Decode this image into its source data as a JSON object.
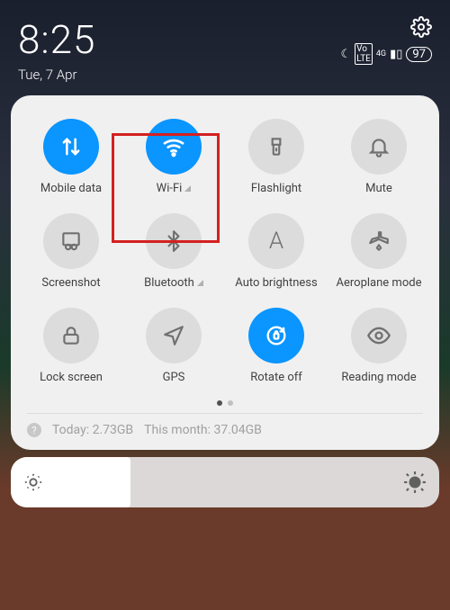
{
  "status": {
    "time": "8:25",
    "date": "Tue, 7 Apr",
    "battery": "97",
    "network": "4G"
  },
  "tiles": [
    {
      "id": "mobile-data",
      "label": "Mobile data",
      "active": true
    },
    {
      "id": "wifi",
      "label": "Wi-Fi",
      "active": true
    },
    {
      "id": "flashlight",
      "label": "Flashlight",
      "active": false
    },
    {
      "id": "mute",
      "label": "Mute",
      "active": false
    },
    {
      "id": "screenshot",
      "label": "Screenshot",
      "active": false
    },
    {
      "id": "bluetooth",
      "label": "Bluetooth",
      "active": false
    },
    {
      "id": "auto-brightness",
      "label": "Auto brightness",
      "active": false
    },
    {
      "id": "aeroplane-mode",
      "label": "Aeroplane mode",
      "active": false
    },
    {
      "id": "lock-screen",
      "label": "Lock screen",
      "active": false
    },
    {
      "id": "gps",
      "label": "GPS",
      "active": false
    },
    {
      "id": "rotate-off",
      "label": "Rotate off",
      "active": true
    },
    {
      "id": "reading-mode",
      "label": "Reading mode",
      "active": false
    }
  ],
  "usage": {
    "today_label": "Today:",
    "today_value": "2.73GB",
    "month_label": "This month:",
    "month_value": "37.04GB"
  },
  "highlight_tile": "wifi"
}
